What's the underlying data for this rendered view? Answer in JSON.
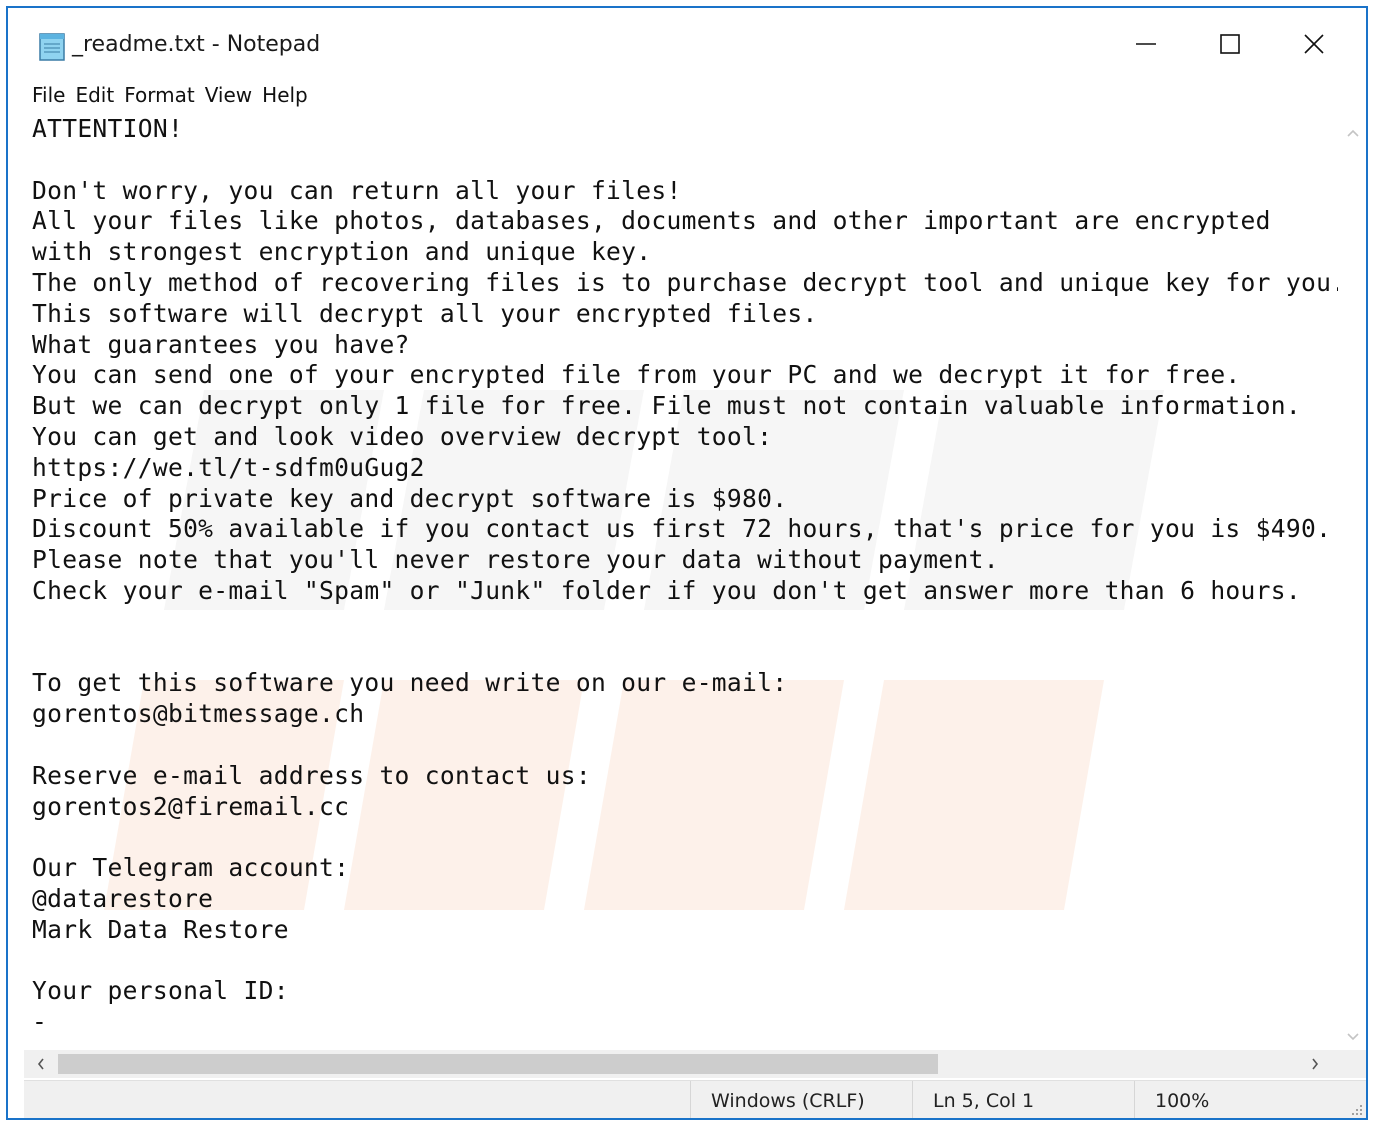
{
  "window": {
    "title": "_readme.txt - Notepad",
    "accent_color": "#1a73c9",
    "app_icon": "notepad-icon",
    "controls": {
      "minimize": "minimize-icon",
      "maximize": "maximize-icon",
      "close": "close-icon"
    }
  },
  "menu": {
    "items": [
      "File",
      "Edit",
      "Format",
      "View",
      "Help"
    ]
  },
  "editor": {
    "content": "ATTENTION!\n\nDon't worry, you can return all your files!\nAll your files like photos, databases, documents and other important are encrypted\nwith strongest encryption and unique key.\nThe only method of recovering files is to purchase decrypt tool and unique key for you.\nThis software will decrypt all your encrypted files.\nWhat guarantees you have?\nYou can send one of your encrypted file from your PC and we decrypt it for free.\nBut we can decrypt only 1 file for free. File must not contain valuable information.\nYou can get and look video overview decrypt tool:\nhttps://we.tl/t-sdfm0uGug2\nPrice of private key and decrypt software is $980.\nDiscount 50% available if you contact us first 72 hours, that's price for you is $490.\nPlease note that you'll never restore your data without payment.\nCheck your e-mail \"Spam\" or \"Junk\" folder if you don't get answer more than 6 hours.\n\n\nTo get this software you need write on our e-mail:\ngorentos@bitmessage.ch\n\nReserve e-mail address to contact us:\ngorentos2@firemail.cc\n\nOur Telegram account:\n@datarestore\nMark Data Restore\n\nYour personal ID:\n-"
  },
  "scrollbars": {
    "vertical_up": "chevron-up-icon",
    "vertical_down": "chevron-down-icon",
    "horizontal_left": "chevron-left-icon",
    "horizontal_right": "chevron-right-icon"
  },
  "status": {
    "line_ending": "Windows (CRLF)",
    "position": "Ln 5, Col 1",
    "zoom": "100%"
  }
}
